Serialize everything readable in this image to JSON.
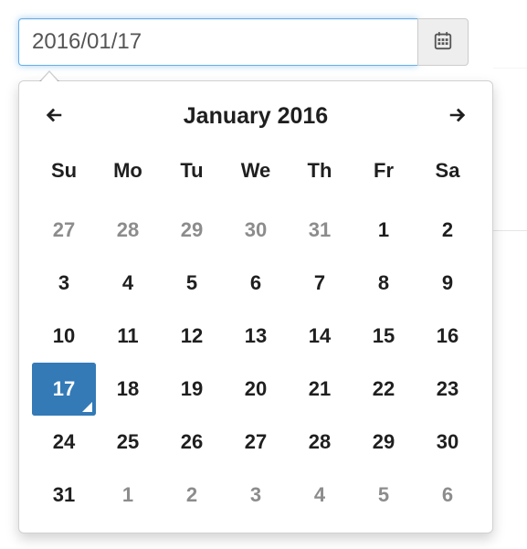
{
  "colors": {
    "accent": "#337ab7",
    "input_focus": "#66afe9",
    "text": "#1f1f1f",
    "muted": "#8c8c8c",
    "addon_bg": "#eeeeee",
    "border": "#cccccc"
  },
  "input": {
    "value": "2016/01/17",
    "placeholder": ""
  },
  "calendar": {
    "title": "January 2016",
    "selected_day": 17,
    "weekdays": [
      "Su",
      "Mo",
      "Tu",
      "We",
      "Th",
      "Fr",
      "Sa"
    ],
    "weeks": [
      [
        {
          "n": 27,
          "muted": true,
          "selected": false
        },
        {
          "n": 28,
          "muted": true,
          "selected": false
        },
        {
          "n": 29,
          "muted": true,
          "selected": false
        },
        {
          "n": 30,
          "muted": true,
          "selected": false
        },
        {
          "n": 31,
          "muted": true,
          "selected": false
        },
        {
          "n": 1,
          "muted": false,
          "selected": false
        },
        {
          "n": 2,
          "muted": false,
          "selected": false
        }
      ],
      [
        {
          "n": 3,
          "muted": false,
          "selected": false
        },
        {
          "n": 4,
          "muted": false,
          "selected": false
        },
        {
          "n": 5,
          "muted": false,
          "selected": false
        },
        {
          "n": 6,
          "muted": false,
          "selected": false
        },
        {
          "n": 7,
          "muted": false,
          "selected": false
        },
        {
          "n": 8,
          "muted": false,
          "selected": false
        },
        {
          "n": 9,
          "muted": false,
          "selected": false
        }
      ],
      [
        {
          "n": 10,
          "muted": false,
          "selected": false
        },
        {
          "n": 11,
          "muted": false,
          "selected": false
        },
        {
          "n": 12,
          "muted": false,
          "selected": false
        },
        {
          "n": 13,
          "muted": false,
          "selected": false
        },
        {
          "n": 14,
          "muted": false,
          "selected": false
        },
        {
          "n": 15,
          "muted": false,
          "selected": false
        },
        {
          "n": 16,
          "muted": false,
          "selected": false
        }
      ],
      [
        {
          "n": 17,
          "muted": false,
          "selected": true
        },
        {
          "n": 18,
          "muted": false,
          "selected": false
        },
        {
          "n": 19,
          "muted": false,
          "selected": false
        },
        {
          "n": 20,
          "muted": false,
          "selected": false
        },
        {
          "n": 21,
          "muted": false,
          "selected": false
        },
        {
          "n": 22,
          "muted": false,
          "selected": false
        },
        {
          "n": 23,
          "muted": false,
          "selected": false
        }
      ],
      [
        {
          "n": 24,
          "muted": false,
          "selected": false
        },
        {
          "n": 25,
          "muted": false,
          "selected": false
        },
        {
          "n": 26,
          "muted": false,
          "selected": false
        },
        {
          "n": 27,
          "muted": false,
          "selected": false
        },
        {
          "n": 28,
          "muted": false,
          "selected": false
        },
        {
          "n": 29,
          "muted": false,
          "selected": false
        },
        {
          "n": 30,
          "muted": false,
          "selected": false
        }
      ],
      [
        {
          "n": 31,
          "muted": false,
          "selected": false
        },
        {
          "n": 1,
          "muted": true,
          "selected": false
        },
        {
          "n": 2,
          "muted": true,
          "selected": false
        },
        {
          "n": 3,
          "muted": true,
          "selected": false
        },
        {
          "n": 4,
          "muted": true,
          "selected": false
        },
        {
          "n": 5,
          "muted": true,
          "selected": false
        },
        {
          "n": 6,
          "muted": true,
          "selected": false
        }
      ]
    ]
  },
  "icons": {
    "calendar": "calendar-icon",
    "prev": "arrow-left-icon",
    "next": "arrow-right-icon"
  }
}
